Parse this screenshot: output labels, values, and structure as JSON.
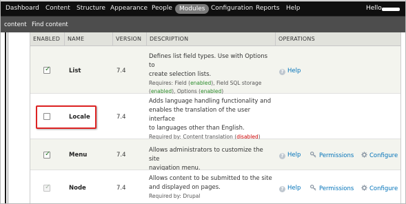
{
  "toolbar": {
    "items": [
      "Dashboard",
      "Content",
      "Structure",
      "Appearance",
      "People",
      "Modules",
      "Configuration",
      "Reports",
      "Help"
    ],
    "active": "Modules",
    "hello": "Hello"
  },
  "shortcuts": [
    "content",
    "Find content"
  ],
  "table": {
    "headers": [
      "ENABLED",
      "NAME",
      "VERSION",
      "DESCRIPTION",
      "OPERATIONS"
    ],
    "rows": [
      {
        "name": "List",
        "version": "7.4",
        "checked": true,
        "disabled": false,
        "desc_lines": [
          "Defines list field types. Use with Options to",
          "create selection lists."
        ],
        "requires_label": "Requires: Field (",
        "req1": "enabled",
        "req_mid1": "), Field SQL storage",
        "req_open2": "(",
        "req2": "enabled",
        "req_mid2": "), Options (",
        "req3": "enabled",
        "req_close": ")",
        "help": "Help"
      },
      {
        "name": "Locale",
        "version": "7.4",
        "checked": false,
        "disabled": false,
        "desc_lines": [
          "Adds language handling functionality and",
          "enables the translation of the user interface",
          "to languages other than English."
        ],
        "required_label": "Required by: Content translation (",
        "required_status": "disabled",
        "required_close": ")"
      },
      {
        "name": "Menu",
        "version": "7.4",
        "checked": true,
        "disabled": false,
        "desc_lines": [
          "Allows administrators to customize the site",
          "navigation menu."
        ],
        "help": "Help",
        "permissions": "Permissions",
        "configure": "Configure"
      },
      {
        "name": "Node",
        "version": "7.4",
        "checked": true,
        "disabled": true,
        "desc_lines": [
          "Allows content to be submitted to the site",
          "and displayed on pages."
        ],
        "required_label": "Required by: Drupal",
        "help": "Help",
        "permissions": "Permissions",
        "configure": "Configure"
      }
    ]
  },
  "colors": {
    "toolbar_bg": "#0f0f0f",
    "shortcut_bg": "#4d4d4d",
    "link": "#0072b9",
    "enabled": "#2a8a2a",
    "disabled": "#cc0000",
    "highlight": "#dd2222"
  }
}
